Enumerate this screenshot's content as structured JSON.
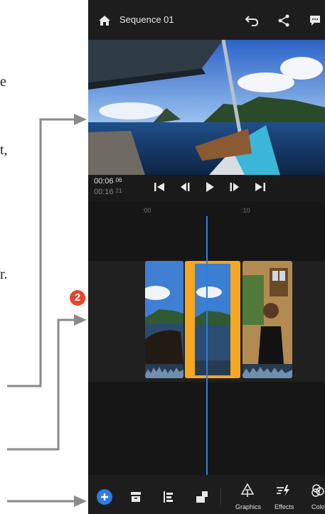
{
  "annotations": {
    "text_fragments": [
      "e",
      "t,",
      "r."
    ],
    "step_badge": "2"
  },
  "app": {
    "sequence_title": "Sequence 01"
  },
  "playback": {
    "current_time": "00:06",
    "current_frames": "06",
    "total_time": "00:16",
    "total_frames": "21"
  },
  "ruler": {
    "mark_start": ":00",
    "mark_ten": ":10"
  },
  "toolbar": {
    "graphics_label": "Graphics",
    "effects_label": "Effects",
    "color_label": "Color"
  },
  "colors": {
    "accent_blue": "#2d7de0",
    "selection_orange": "#f5a623",
    "badge_red": "#e8452c"
  },
  "icons": [
    "home-icon",
    "undo-icon",
    "share-icon",
    "comment-icon",
    "skip-back-icon",
    "step-back-icon",
    "play-icon",
    "step-forward-icon",
    "skip-forward-icon",
    "add-icon",
    "archive-icon",
    "align-icon",
    "layers-icon",
    "graphics-icon",
    "effects-icon",
    "color-icon"
  ]
}
